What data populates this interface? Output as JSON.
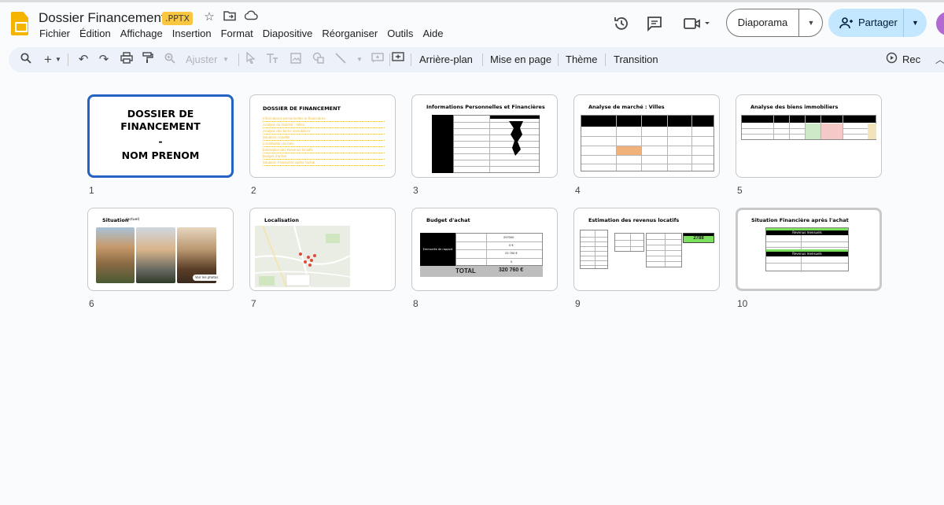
{
  "app": {
    "doc_title": "Dossier Financement",
    "file_badge": ".PPTX",
    "menu": [
      "Fichier",
      "Édition",
      "Affichage",
      "Insertion",
      "Format",
      "Diapositive",
      "Réorganiser",
      "Outils",
      "Aide"
    ],
    "slideshow_label": "Diaporama",
    "share_label": "Partager"
  },
  "toolbar": {
    "zoom_label": "Ajuster",
    "background_label": "Arrière-plan",
    "layout_label": "Mise en page",
    "theme_label": "Thème",
    "transition_label": "Transition",
    "record_label": "Rec"
  },
  "slides": [
    {
      "number": "1",
      "title_lines": [
        "DOSSIER DE",
        "FINANCEMENT",
        "-",
        "NOM PRENOM"
      ]
    },
    {
      "number": "2",
      "title": "DOSSIER DE FINANCEMENT",
      "toc": [
        "Informations personnelles et financières",
        "Analyse du marché : Villes",
        "Analyse des biens immobiliers",
        "Situation Actuelle",
        "Localisation du bien",
        "Estimation des Revenus locatifs",
        "Budget d'achat",
        "Situation Financière après l'achat"
      ]
    },
    {
      "number": "3",
      "title": "Informations Personnelles et Financières"
    },
    {
      "number": "4",
      "title": "Analyse de marché : Villes"
    },
    {
      "number": "5",
      "title": "Analyse des biens immobiliers"
    },
    {
      "number": "6",
      "title": "Situation",
      "subtitle": "(actuel)",
      "photo_caption": "Voir les photos"
    },
    {
      "number": "7",
      "title": "Localisation"
    },
    {
      "number": "8",
      "title": "Budget d'achat",
      "total_label": "TOTAL",
      "total_value": "320 760 €",
      "row_label": "Emmorrée de rapport",
      "rows": [
        "297000",
        "0 €",
        "23 760 €",
        "0"
      ]
    },
    {
      "number": "9",
      "title": "Estimation des revenus locatifs",
      "highlight_value": "2788"
    },
    {
      "number": "10",
      "title": "Situation Financière après l'achat",
      "section_a": "Revenus mensuels",
      "section_b": "Revenus mensuels"
    }
  ],
  "colors": {
    "accent_blue": "#2463c4",
    "share_bg": "#c2e7ff",
    "toolbar_bg": "#edf2fa",
    "badge": "#f9c642",
    "logo": "#f4b400",
    "highlight_green": "#7be05b",
    "toc_yellow": "#f0c040"
  }
}
